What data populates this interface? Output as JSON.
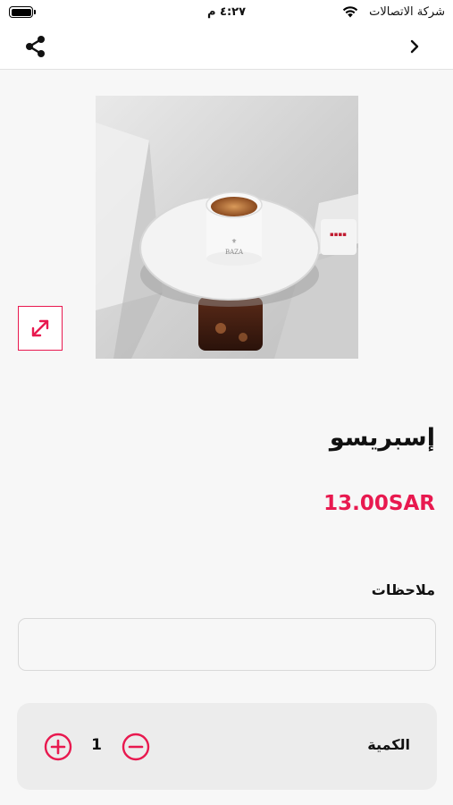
{
  "status_bar": {
    "time": "٤:٢٧ م",
    "carrier": "شركة الاتصالات"
  },
  "nav": {
    "share_icon": "share-icon",
    "back_icon": "chevron-right-icon"
  },
  "product": {
    "image_alt": "espresso-cup-photo",
    "name": "إسبريسو",
    "price": "13.00SAR",
    "expand_icon": "expand-icon"
  },
  "notes": {
    "label": "ملاحظات",
    "value": "",
    "placeholder": ""
  },
  "quantity": {
    "label": "الكمية",
    "value": "1",
    "decrease_icon": "minus-circle-icon",
    "increase_icon": "plus-circle-icon"
  },
  "colors": {
    "accent": "#e8194f",
    "background": "#f7f7f7",
    "card": "#ececec"
  }
}
